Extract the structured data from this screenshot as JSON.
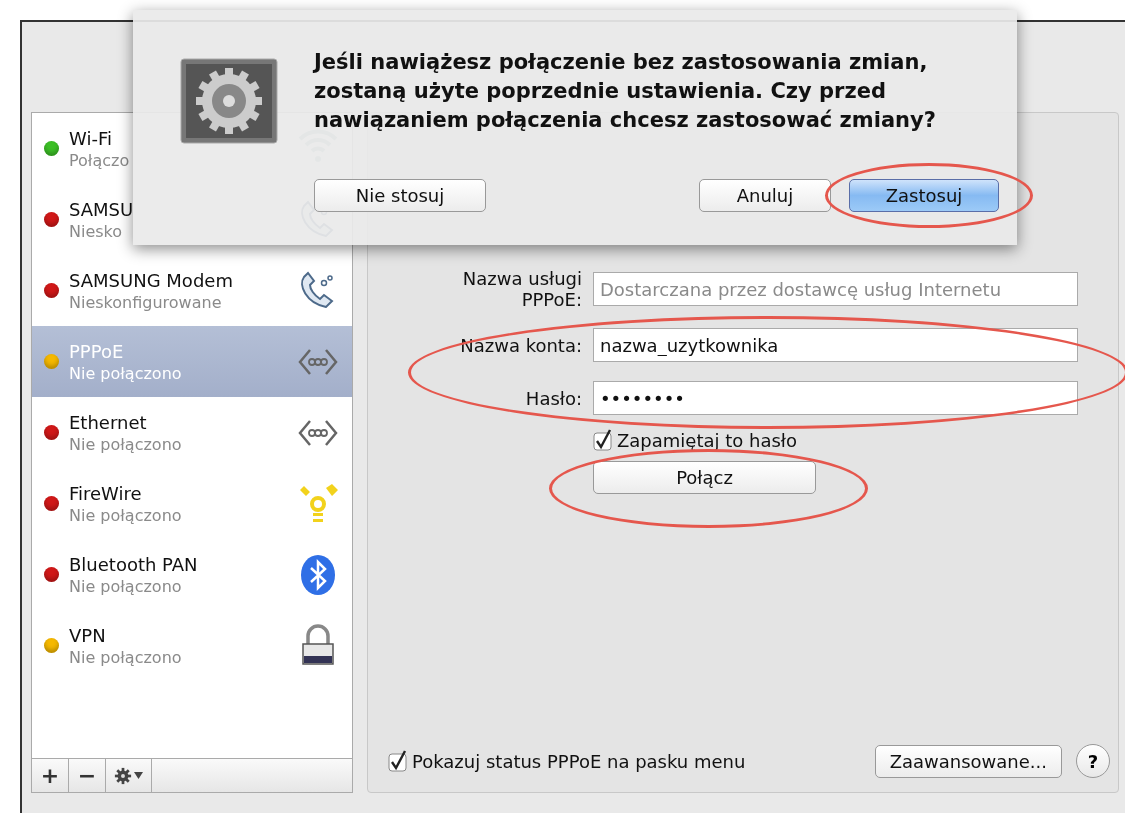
{
  "sidebar": {
    "items": [
      {
        "name": "Wi-Fi",
        "status": "Połączo",
        "color": "#3cbf26",
        "selected": false,
        "kind": "wifi"
      },
      {
        "name": "SAMSU",
        "status": "Niesko",
        "color": "#d01818",
        "selected": false,
        "kind": "phone"
      },
      {
        "name": "SAMSUNG Modem",
        "status": "Nieskonfigurowane",
        "color": "#d01818",
        "selected": false,
        "kind": "phone"
      },
      {
        "name": "PPPoE",
        "status": "Nie połączono",
        "color": "#f5b800",
        "selected": true,
        "kind": "ethernet"
      },
      {
        "name": "Ethernet",
        "status": "Nie połączono",
        "color": "#d01818",
        "selected": false,
        "kind": "ethernet"
      },
      {
        "name": "FireWire",
        "status": "Nie połączono",
        "color": "#d01818",
        "selected": false,
        "kind": "firewire"
      },
      {
        "name": "Bluetooth PAN",
        "status": "Nie połączono",
        "color": "#d01818",
        "selected": false,
        "kind": "bluetooth"
      },
      {
        "name": "VPN",
        "status": "Nie połączono",
        "color": "#f5b800",
        "selected": false,
        "kind": "lock"
      }
    ],
    "add": "+",
    "remove": "−"
  },
  "detail": {
    "service_field": {
      "label": "Nazwa usługi PPPoE:",
      "placeholder": "Dostarczana przez dostawcę usług Internetu"
    },
    "credentials": {
      "circled": true,
      "fields": [
        {
          "label": "Nazwa konta:",
          "value": "nazwa_uzytkownika"
        },
        {
          "label": "Hasło:",
          "value": "••••••••"
        }
      ]
    },
    "remember": {
      "label": "Zapamiętaj to hasło",
      "checked": true
    },
    "connect": {
      "label": "Połącz",
      "circled": true
    },
    "menu_status": {
      "label": "Pokazuj status PPPoE na pasku menu",
      "checked": true
    },
    "advanced": "Zaawansowane...",
    "help": "?"
  },
  "dialog": {
    "message": "Jeśli nawiążesz połączenie bez zastosowania zmian, zostaną użyte poprzednie ustawienia. Czy przed nawiązaniem połączenia chcesz zastosować zmiany?",
    "buttons": [
      {
        "label": "Nie stosuj",
        "default": false,
        "circled": false
      },
      {
        "label": "Anuluj",
        "default": false,
        "circled": false
      },
      {
        "label": "Zastosuj",
        "default": true,
        "circled": true
      }
    ]
  }
}
